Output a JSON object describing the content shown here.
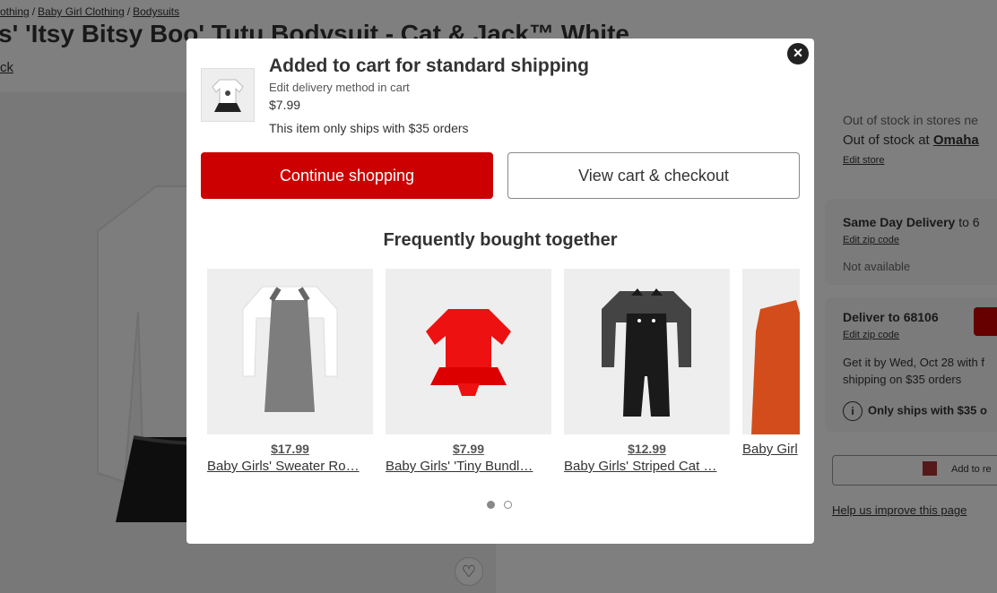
{
  "breadcrumb": [
    "othing",
    "Baby Girl Clothing",
    "Bodysuits"
  ],
  "product_title": "s' 'Itsy Bitsy Boo' Tutu Bodysuit - Cat & Jack™ White",
  "back_link": "ck",
  "fulfillment": {
    "store_line1": "Out of stock in stores ne",
    "store_line2_prefix": "Out of stock at ",
    "store_city": "Omaha",
    "edit_store": "Edit store",
    "same_day_label": "Same Day Delivery",
    "same_day_suffix": " to 6",
    "edit_zip_1": "Edit zip code",
    "not_available": "Not available",
    "deliver_label": "Deliver",
    "deliver_suffix": " to 68106",
    "edit_zip_2": "Edit zip code",
    "get_it_line1": "Get it by Wed, Oct 28 with f",
    "get_it_line2": "shipping on $35 orders",
    "only_ships": "Only ships with $35 o",
    "registry_label": "Add to re",
    "help_link": "Help us improve this page"
  },
  "modal": {
    "title": "Added to cart for standard shipping",
    "edit_delivery": "Edit delivery method in cart",
    "price": "$7.99",
    "ship_note": "This item only ships with $35 orders",
    "continue_label": "Continue shopping",
    "view_cart_label": "View cart & checkout",
    "fbt_title": "Frequently bought together",
    "close_symbol": "×"
  },
  "recommendations": [
    {
      "price": "$17.99",
      "name": "Baby Girls' Sweater Ro…"
    },
    {
      "price": "$7.99",
      "name": "Baby Girls' 'Tiny Bundl…"
    },
    {
      "price": "$12.99",
      "name": "Baby Girls' Striped Cat …"
    },
    {
      "price": "",
      "name": "Baby Girl"
    }
  ],
  "carousel": {
    "pages": 2,
    "active_page": 1
  },
  "colors": {
    "primary_red": "#cc0000",
    "overlay": "rgba(0,0,0,0.5)"
  }
}
